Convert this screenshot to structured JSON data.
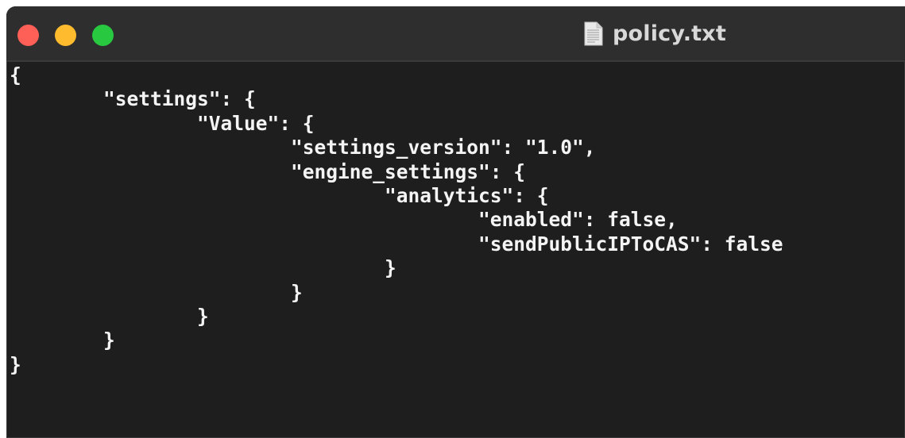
{
  "window": {
    "title": "policy.txt",
    "title_icon": "text-document-icon",
    "controls": [
      "close",
      "minimize",
      "zoom"
    ],
    "colors": {
      "close": "#fe5f57",
      "minimize": "#febb2e",
      "zoom": "#28c840",
      "editor_background": "#1e1e1e",
      "text": "#f4f4f4"
    }
  },
  "editor": {
    "lines": [
      "{",
      "\t\"settings\": {",
      "\t\t\"Value\": {",
      "\t\t\t\"settings_version\": \"1.0\",",
      "\t\t\t\"engine_settings\": {",
      "\t\t\t\t\"analytics\": {",
      "\t\t\t\t\t\"enabled\": false,",
      "\t\t\t\t\t\"sendPublicIPToCAS\": false",
      "\t\t\t\t}",
      "\t\t\t}",
      "\t\t}",
      "\t}",
      "}"
    ]
  }
}
